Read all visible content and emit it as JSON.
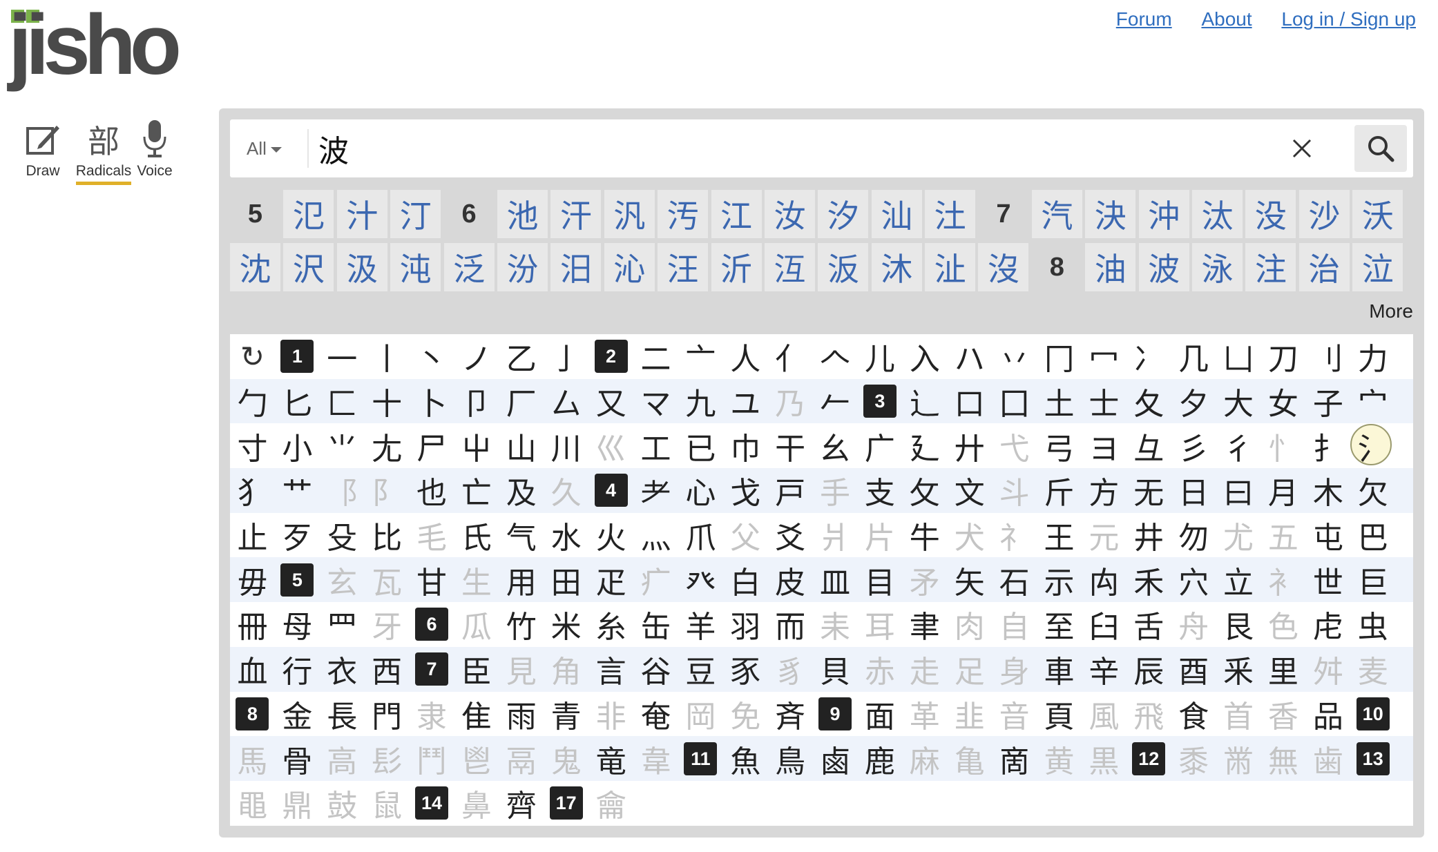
{
  "logo": "jisho",
  "nav": [
    "Forum",
    "About",
    "Log in / Sign up"
  ],
  "tools": [
    {
      "label": "Draw",
      "icon": "pencil-edit-icon"
    },
    {
      "label": "Radicals",
      "icon": "部"
    },
    {
      "label": "Voice",
      "icon": "microphone-icon"
    }
  ],
  "search": {
    "scope": "All",
    "query": "波"
  },
  "results": {
    "rows": [
      [
        "5",
        "氾",
        "汁",
        "汀",
        "6",
        "池",
        "汗",
        "汎",
        "汚",
        "江",
        "汝",
        "汐",
        "汕",
        "汢",
        "7",
        "汽",
        "決",
        "沖",
        "汰",
        "没",
        "沙",
        "沃"
      ],
      [
        "沈",
        "沢",
        "汲",
        "沌",
        "泛",
        "汾",
        "汨",
        "沁",
        "汪",
        "沂",
        "沍",
        "汳",
        "沐",
        "沚",
        "沒",
        "8",
        "油",
        "波",
        "泳",
        "注",
        "治",
        "泣"
      ]
    ],
    "more": "More"
  },
  "radicals": {
    "rows": [
      [
        [
          "↻",
          "r"
        ],
        [
          "1",
          "s"
        ],
        [
          "一"
        ],
        [
          "丨"
        ],
        [
          "丶"
        ],
        [
          "ノ"
        ],
        [
          "乙"
        ],
        [
          "亅"
        ],
        [
          "2",
          "s"
        ],
        [
          "二"
        ],
        [
          "亠"
        ],
        [
          "人"
        ],
        [
          "亻"
        ],
        [
          "𠆢"
        ],
        [
          "儿"
        ],
        [
          "入"
        ],
        [
          "ハ"
        ],
        [
          "丷"
        ],
        [
          "冂"
        ],
        [
          "冖"
        ],
        [
          "冫"
        ],
        [
          "几"
        ],
        [
          "凵"
        ],
        [
          "刀"
        ],
        [
          "刂"
        ],
        [
          "力"
        ]
      ],
      [
        [
          "勹"
        ],
        [
          "匕"
        ],
        [
          "匚"
        ],
        [
          "十"
        ],
        [
          "卜"
        ],
        [
          "卩"
        ],
        [
          "厂"
        ],
        [
          "厶"
        ],
        [
          "又"
        ],
        [
          "マ"
        ],
        [
          "九"
        ],
        [
          "ユ"
        ],
        [
          "乃",
          "d"
        ],
        [
          "𠂉"
        ],
        [
          "3",
          "s"
        ],
        [
          "⻌"
        ],
        [
          "口"
        ],
        [
          "囗"
        ],
        [
          "土"
        ],
        [
          "士"
        ],
        [
          "夂"
        ],
        [
          "夕"
        ],
        [
          "大"
        ],
        [
          "女"
        ],
        [
          "子"
        ],
        [
          "宀"
        ]
      ],
      [
        [
          "寸"
        ],
        [
          "小"
        ],
        [
          "⺌"
        ],
        [
          "尢"
        ],
        [
          "尸"
        ],
        [
          "屮"
        ],
        [
          "山"
        ],
        [
          "川"
        ],
        [
          "巛",
          "d"
        ],
        [
          "工"
        ],
        [
          "已"
        ],
        [
          "巾"
        ],
        [
          "干"
        ],
        [
          "幺"
        ],
        [
          "广"
        ],
        [
          "廴"
        ],
        [
          "廾"
        ],
        [
          "弋",
          "d"
        ],
        [
          "弓"
        ],
        [
          "ヨ"
        ],
        [
          "彑"
        ],
        [
          "彡"
        ],
        [
          "彳"
        ],
        [
          "忄",
          "d"
        ],
        [
          "扌"
        ],
        [
          "氵",
          "x"
        ]
      ],
      [
        [
          "犭"
        ],
        [
          "艹"
        ],
        [
          "⻏",
          "d"
        ],
        [
          "⻖",
          "d"
        ],
        [
          "也"
        ],
        [
          "亡"
        ],
        [
          "及"
        ],
        [
          "久",
          "d"
        ],
        [
          "4",
          "s"
        ],
        [
          "⺹"
        ],
        [
          "心"
        ],
        [
          "戈"
        ],
        [
          "戸"
        ],
        [
          "手",
          "d"
        ],
        [
          "支"
        ],
        [
          "攵"
        ],
        [
          "文"
        ],
        [
          "斗",
          "d"
        ],
        [
          "斤"
        ],
        [
          "方"
        ],
        [
          "无"
        ],
        [
          "日"
        ],
        [
          "曰"
        ],
        [
          "月"
        ],
        [
          "木"
        ],
        [
          "欠"
        ]
      ],
      [
        [
          "止"
        ],
        [
          "歹"
        ],
        [
          "殳"
        ],
        [
          "比"
        ],
        [
          "毛",
          "d"
        ],
        [
          "氏"
        ],
        [
          "气"
        ],
        [
          "水"
        ],
        [
          "火"
        ],
        [
          "灬"
        ],
        [
          "爪"
        ],
        [
          "父",
          "d"
        ],
        [
          "爻"
        ],
        [
          "爿",
          "d"
        ],
        [
          "片",
          "d"
        ],
        [
          "牛"
        ],
        [
          "犬",
          "d"
        ],
        [
          "⺭",
          "d"
        ],
        [
          "王"
        ],
        [
          "元",
          "d"
        ],
        [
          "井"
        ],
        [
          "勿"
        ],
        [
          "尤",
          "d"
        ],
        [
          "五",
          "d"
        ],
        [
          "屯"
        ],
        [
          "巴"
        ]
      ],
      [
        [
          "毋"
        ],
        [
          "5",
          "s"
        ],
        [
          "玄",
          "d"
        ],
        [
          "瓦",
          "d"
        ],
        [
          "甘"
        ],
        [
          "生",
          "d"
        ],
        [
          "用"
        ],
        [
          "田"
        ],
        [
          "疋"
        ],
        [
          "疒",
          "d"
        ],
        [
          "癶"
        ],
        [
          "白"
        ],
        [
          "皮"
        ],
        [
          "皿"
        ],
        [
          "目"
        ],
        [
          "矛",
          "d"
        ],
        [
          "矢"
        ],
        [
          "石"
        ],
        [
          "示"
        ],
        [
          "禸"
        ],
        [
          "禾"
        ],
        [
          "穴"
        ],
        [
          "立"
        ],
        [
          "⻂",
          "d"
        ],
        [
          "世"
        ],
        [
          "巨"
        ]
      ],
      [
        [
          "冊"
        ],
        [
          "母"
        ],
        [
          "⺲"
        ],
        [
          "牙",
          "d"
        ],
        [
          "6",
          "s"
        ],
        [
          "瓜",
          "d"
        ],
        [
          "竹"
        ],
        [
          "米"
        ],
        [
          "糸"
        ],
        [
          "缶"
        ],
        [
          "羊"
        ],
        [
          "羽"
        ],
        [
          "而"
        ],
        [
          "耒",
          "d"
        ],
        [
          "耳",
          "d"
        ],
        [
          "聿"
        ],
        [
          "肉",
          "d"
        ],
        [
          "自",
          "d"
        ],
        [
          "至"
        ],
        [
          "臼"
        ],
        [
          "舌"
        ],
        [
          "舟",
          "d"
        ],
        [
          "艮"
        ],
        [
          "色",
          "d"
        ],
        [
          "虍"
        ],
        [
          "虫"
        ]
      ],
      [
        [
          "血"
        ],
        [
          "行"
        ],
        [
          "衣"
        ],
        [
          "西"
        ],
        [
          "7",
          "s"
        ],
        [
          "臣"
        ],
        [
          "見",
          "d"
        ],
        [
          "角",
          "d"
        ],
        [
          "言"
        ],
        [
          "谷"
        ],
        [
          "豆"
        ],
        [
          "豕"
        ],
        [
          "豸",
          "d"
        ],
        [
          "貝"
        ],
        [
          "赤",
          "d"
        ],
        [
          "走",
          "d"
        ],
        [
          "足",
          "d"
        ],
        [
          "身",
          "d"
        ],
        [
          "車"
        ],
        [
          "辛"
        ],
        [
          "辰"
        ],
        [
          "酉"
        ],
        [
          "釆"
        ],
        [
          "里"
        ],
        [
          "舛",
          "d"
        ],
        [
          "麦",
          "d"
        ]
      ],
      [
        [
          "8",
          "s"
        ],
        [
          "金"
        ],
        [
          "長"
        ],
        [
          "門"
        ],
        [
          "隶",
          "d"
        ],
        [
          "隹"
        ],
        [
          "雨"
        ],
        [
          "青"
        ],
        [
          "非",
          "d"
        ],
        [
          "奄"
        ],
        [
          "岡",
          "d"
        ],
        [
          "免",
          "d"
        ],
        [
          "斉"
        ],
        [
          "9",
          "s"
        ],
        [
          "面"
        ],
        [
          "革",
          "d"
        ],
        [
          "韭",
          "d"
        ],
        [
          "音",
          "d"
        ],
        [
          "頁"
        ],
        [
          "風",
          "d"
        ],
        [
          "飛",
          "d"
        ],
        [
          "食"
        ],
        [
          "首",
          "d"
        ],
        [
          "香",
          "d"
        ],
        [
          "品"
        ],
        [
          "10",
          "s"
        ]
      ],
      [
        [
          "馬",
          "d"
        ],
        [
          "骨"
        ],
        [
          "高",
          "d"
        ],
        [
          "髟",
          "d"
        ],
        [
          "鬥",
          "d"
        ],
        [
          "鬯",
          "d"
        ],
        [
          "鬲",
          "d"
        ],
        [
          "鬼",
          "d"
        ],
        [
          "竜"
        ],
        [
          "韋",
          "d"
        ],
        [
          "11",
          "s"
        ],
        [
          "魚"
        ],
        [
          "鳥"
        ],
        [
          "鹵"
        ],
        [
          "鹿"
        ],
        [
          "麻",
          "d"
        ],
        [
          "亀",
          "d"
        ],
        [
          "啇"
        ],
        [
          "黄",
          "d"
        ],
        [
          "黒",
          "d"
        ],
        [
          "12",
          "s"
        ],
        [
          "黍",
          "d"
        ],
        [
          "黹",
          "d"
        ],
        [
          "無",
          "d"
        ],
        [
          "歯",
          "d"
        ],
        [
          "13",
          "s"
        ]
      ],
      [
        [
          "黽",
          "d"
        ],
        [
          "鼎",
          "d"
        ],
        [
          "鼓",
          "d"
        ],
        [
          "鼠",
          "d"
        ],
        [
          "14",
          "s"
        ],
        [
          "鼻",
          "d"
        ],
        [
          "齊"
        ],
        [
          "17",
          "s"
        ],
        [
          "龠",
          "d"
        ]
      ]
    ]
  }
}
